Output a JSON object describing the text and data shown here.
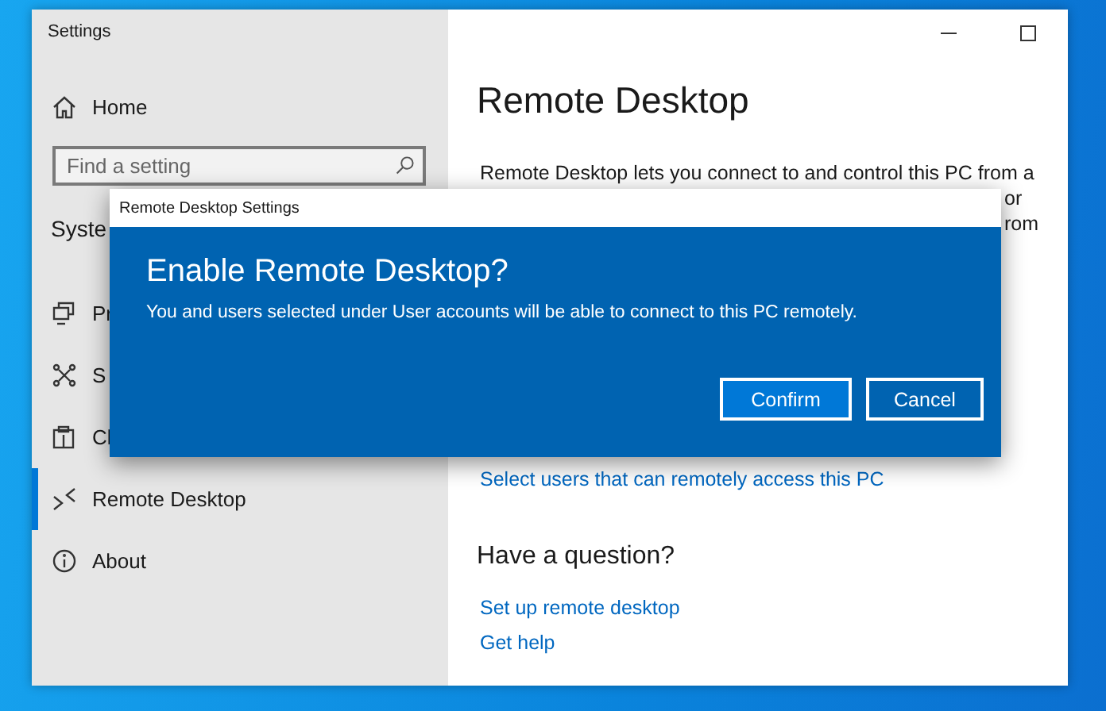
{
  "window": {
    "title": "Settings"
  },
  "sidebar": {
    "home": "Home",
    "search": {
      "placeholder": "Find a setting"
    },
    "section": "Syste",
    "items": [
      {
        "label": "Pr",
        "selected": false
      },
      {
        "label": "S",
        "selected": false
      },
      {
        "label": "Cl",
        "selected": false
      },
      {
        "label": "Remote Desktop",
        "selected": true
      },
      {
        "label": "About",
        "selected": false
      }
    ]
  },
  "content": {
    "title": "Remote Desktop",
    "description": "Remote Desktop lets you connect to and control this PC from a",
    "description_fragments": [
      "or",
      "rom"
    ],
    "link": "Select users that can remotely access this PC",
    "help": {
      "heading": "Have a question?",
      "links": [
        "Set up remote desktop",
        "Get help"
      ]
    }
  },
  "dialog": {
    "title": "Remote Desktop Settings",
    "heading": "Enable Remote Desktop?",
    "message": "You and users selected under User accounts will be able to connect to this PC remotely.",
    "buttons": [
      {
        "label": "Confirm",
        "kind": "primary"
      },
      {
        "label": "Cancel",
        "kind": "secondary"
      }
    ]
  }
}
